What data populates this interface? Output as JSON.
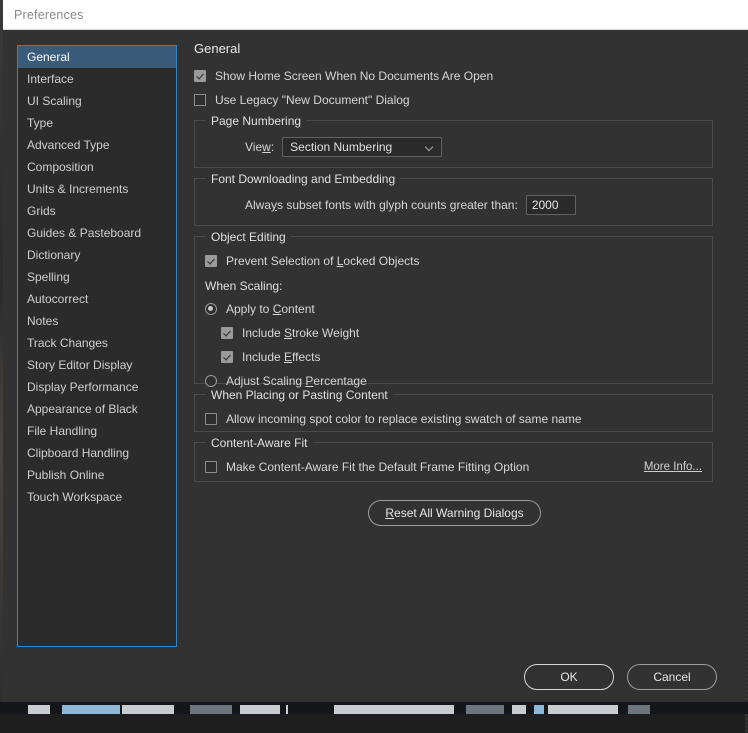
{
  "window": {
    "title": "Preferences"
  },
  "sidebar": {
    "items": [
      {
        "label": "General",
        "selected": true
      },
      {
        "label": "Interface",
        "selected": false
      },
      {
        "label": "UI Scaling",
        "selected": false
      },
      {
        "label": "Type",
        "selected": false
      },
      {
        "label": "Advanced Type",
        "selected": false
      },
      {
        "label": "Composition",
        "selected": false
      },
      {
        "label": "Units & Increments",
        "selected": false
      },
      {
        "label": "Grids",
        "selected": false
      },
      {
        "label": "Guides & Pasteboard",
        "selected": false
      },
      {
        "label": "Dictionary",
        "selected": false
      },
      {
        "label": "Spelling",
        "selected": false
      },
      {
        "label": "Autocorrect",
        "selected": false
      },
      {
        "label": "Notes",
        "selected": false
      },
      {
        "label": "Track Changes",
        "selected": false
      },
      {
        "label": "Story Editor Display",
        "selected": false
      },
      {
        "label": "Display Performance",
        "selected": false
      },
      {
        "label": "Appearance of Black",
        "selected": false
      },
      {
        "label": "File Handling",
        "selected": false
      },
      {
        "label": "Clipboard Handling",
        "selected": false
      },
      {
        "label": "Publish Online",
        "selected": false
      },
      {
        "label": "Touch Workspace",
        "selected": false
      }
    ]
  },
  "main": {
    "panel_title": "General",
    "show_home_screen": {
      "label": "Show Home Screen When No Documents Are Open",
      "checked": true
    },
    "use_legacy_dialog": {
      "label": "Use Legacy \"New Document\" Dialog",
      "checked": false
    },
    "page_numbering": {
      "legend": "Page Numbering",
      "view_label": "View:",
      "view_value": "Section Numbering"
    },
    "font_downloading": {
      "legend": "Font Downloading and Embedding",
      "subset_label": "Always subset fonts with glyph counts greater than:",
      "subset_value": "2000"
    },
    "object_editing": {
      "legend": "Object Editing",
      "prevent_selection": {
        "label": "Prevent Selection of Locked Objects",
        "checked": true
      },
      "when_scaling_label": "When Scaling:",
      "apply_to_content": {
        "label": "Apply to Content",
        "selected": true
      },
      "include_stroke_weight": {
        "label": "Include Stroke Weight",
        "checked": true
      },
      "include_effects": {
        "label": "Include Effects",
        "checked": true
      },
      "adjust_scaling_percentage": {
        "label": "Adjust Scaling Percentage",
        "selected": false
      }
    },
    "placing_pasting": {
      "legend": "When Placing or Pasting Content",
      "allow_spot_color": {
        "label": "Allow incoming spot color to replace existing swatch of same name",
        "checked": false
      }
    },
    "content_aware_fit": {
      "legend": "Content-Aware Fit",
      "make_default": {
        "label": "Make Content-Aware Fit the Default Frame Fitting Option",
        "checked": false
      },
      "more_info_link": "More Info..."
    },
    "reset_button": "Reset All Warning Dialogs"
  },
  "footer": {
    "ok_label": "OK",
    "cancel_label": "Cancel"
  },
  "colors": {
    "window_bg": "#323232",
    "sidebar_bg": "#2b2b2b",
    "sidebar_border": "#3f7fb8",
    "selection_blue": "#3b5b7b",
    "titlebar_bg": "#ffffff",
    "text": "#d4d4d4"
  }
}
